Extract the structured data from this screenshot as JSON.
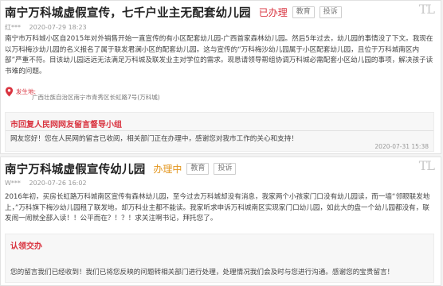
{
  "posts": [
    {
      "title": "南宁万科城虚假宣传，七千户业主无配套幼儿园",
      "status": "已办理",
      "tags": [
        "教育",
        "投诉"
      ],
      "user": "红***",
      "time": "2020-07-29 18:23",
      "body": "南宁市万科城小区自2015年对外销售开始一直宣传的有小区配套幼儿园-广西首家森林幼儿园。然后5年过去，幼儿园的事情没了下文。我现在以万科梅沙幼儿园的名义报名了属于联发君澜小区的配套幼儿园。这与宣传的“万科梅沙幼儿园属于小区配套幼儿园，且位于万科城南区内部”严重不符。目该幼儿园远远无法满足万科城及联发业主对学位的需求。现恳请领导帮组协调万科城必需配套小区幼儿园的事项，解决孩子读书难的问题。",
      "location_badge": "发生地:",
      "location": "广西壮族自治区南宁市青秀区长虹路7号(万科城)",
      "reply": {
        "title": "市回复人民网网友留言督导小组",
        "text": "网友您好！您在人民网的留言已收阅，相关部门正在办理中，感谢您对我市工作的关心和支持！",
        "time": "2020-07-31 15:38"
      }
    },
    {
      "title": "南宁万科城虚假宣传幼儿园",
      "status": "办理中",
      "tags": [
        "教育",
        "投诉"
      ],
      "user": "W***",
      "time": "2020-07-26 16:02",
      "body": "2016年初，买房长虹路万科城南区宣传有森林幼儿园，至今过去万科城却没有消息，我家两个小孩家门口没有幼儿园读，而一墙“邻眼联发地上，”万科旗下梅沙幼儿园租了联发地，却万科业主都不能读。我家听求申诉万科城南区实现家门口幼儿园，如此大的盘一个幼儿园都没有，联发闹一闹就全部入读！！公平而在？！？！求关注啊书记，拜托您了。",
      "reply": {
        "title": "认领交办",
        "text": "您的留言我们已经收到！我们已将您反映的问题转相关部门进行处理，处理情况我们会及时与您进行沟通。感谢您的宝贵留言！"
      }
    }
  ],
  "colors": {
    "status_done": "#d9333f",
    "status_doing": "#e3961e",
    "reply_title": "#d9333f"
  },
  "icons": {
    "location": "location-pin-icon"
  }
}
